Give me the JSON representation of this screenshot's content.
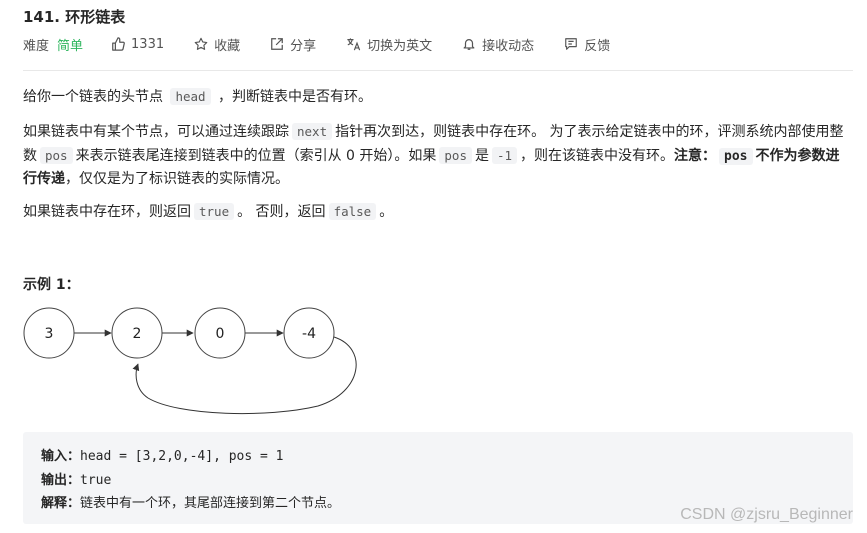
{
  "problem": {
    "title": "141. 环形链表",
    "difficulty_label": "难度",
    "difficulty": "简单",
    "likes": "1331",
    "favorite": "收藏",
    "share": "分享",
    "translate": "切换为英文",
    "notify": "接收动态",
    "feedback": "反馈"
  },
  "description": {
    "p1": [
      "给你一个链表的头节点",
      "head",
      "，判断链表中是否有环。"
    ],
    "p2": [
      "如果链表中有某个节点，可以通过连续跟踪",
      "next",
      "指针再次到达，则链表中存在环。 为了表示给定链表中的环，评测系统内部使用整数",
      "pos",
      "来表示链表尾连接到链表中的位置（索引从 0 开始）。如果",
      "pos",
      "是",
      "-1",
      "，则在该链表中没有环。",
      "注意：",
      "pos",
      "不作为参数进行传递",
      "，仅仅是为了标识链表的实际情况。"
    ],
    "p3": [
      "如果链表中存在环，则返回",
      "true",
      "。 否则，返回",
      "false",
      "。"
    ]
  },
  "example": {
    "title": "示例 1：",
    "nodes": [
      "3",
      "2",
      "0",
      "-4"
    ],
    "input_label": "输入：",
    "input_value": "head = [3,2,0,-4], pos = 1",
    "output_label": "输出：",
    "output_value": "true",
    "explain_label": "解释：",
    "explain_value": "链表中有一个环，其尾部连接到第二个节点。"
  },
  "watermark": "CSDN @zjsru_Beginner"
}
